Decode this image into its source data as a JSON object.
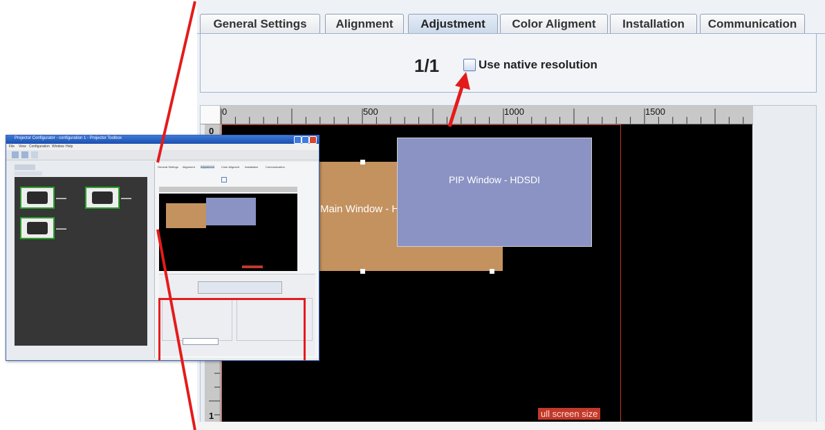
{
  "tabs": [
    {
      "label": "General Settings",
      "active": false
    },
    {
      "label": "Alignment",
      "active": false
    },
    {
      "label": "Adjustment",
      "active": true
    },
    {
      "label": "Color Aligment",
      "active": false
    },
    {
      "label": "Installation",
      "active": false
    },
    {
      "label": "Communication",
      "active": false
    }
  ],
  "adjustment": {
    "page_indicator": "1/1",
    "native_resolution_label": "Use native resolution",
    "native_resolution_checked": false
  },
  "ruler": {
    "horizontal_labels": [
      "0",
      "500",
      "1000",
      "1500"
    ],
    "vertical_top": "0",
    "vertical_bottom": "1"
  },
  "canvas": {
    "main_window_label": "Main Window - H",
    "pip_window_label": "PIP Window - HDSDI",
    "fullscreen_label": "ull screen size"
  },
  "colors": {
    "main_window": "#c4925f",
    "pip_window": "#8a93c4",
    "canvas_bg": "#000000",
    "highlight": "#e41b1b",
    "active_tab": "#ccd9ea"
  },
  "overview": {
    "title_text": "Projector Configurator - configuration 1 - Projector Toolbox",
    "menu": [
      "File",
      "View",
      "Configuration",
      "Window",
      "Help"
    ],
    "tab_labels": [
      "General Settings",
      "Alignment",
      "Adjustment",
      "Color Aligment",
      "Installation",
      "Communication"
    ]
  }
}
